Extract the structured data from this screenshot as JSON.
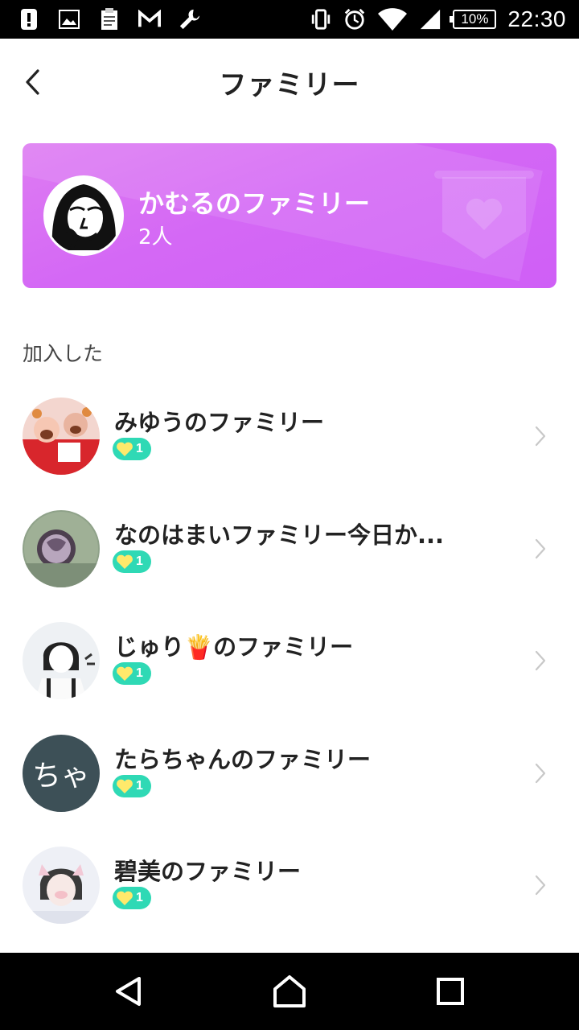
{
  "status_bar": {
    "left_icons": [
      "alert-icon",
      "image-icon",
      "clipboard-icon",
      "gmail-icon",
      "wrench-icon"
    ],
    "right_icons": [
      "vibrate-icon",
      "alarm-icon",
      "wifi-icon",
      "signal-icon"
    ],
    "battery": "10%",
    "time": "22:30"
  },
  "header": {
    "title": "ファミリー"
  },
  "banner": {
    "name": "かむるのファミリー",
    "member_count": "2人",
    "gradient": [
      "#de7cf2",
      "#cf5ff6"
    ]
  },
  "section": {
    "label": "加入した"
  },
  "families": [
    {
      "name": "みゆうのファミリー",
      "badge_count": "1"
    },
    {
      "name": "なのはまいファミリー今日か...",
      "badge_count": "1"
    },
    {
      "name": "じゅり🍟のファミリー",
      "badge_count": "1"
    },
    {
      "name": "たらちゃんのファミリー",
      "badge_count": "1",
      "avatar_text": "ちゃ"
    },
    {
      "name": "碧美のファミリー",
      "badge_count": "1"
    }
  ],
  "colors": {
    "badge": "#2fd9b5",
    "heart": "#ffe96b",
    "text": "#222222"
  }
}
